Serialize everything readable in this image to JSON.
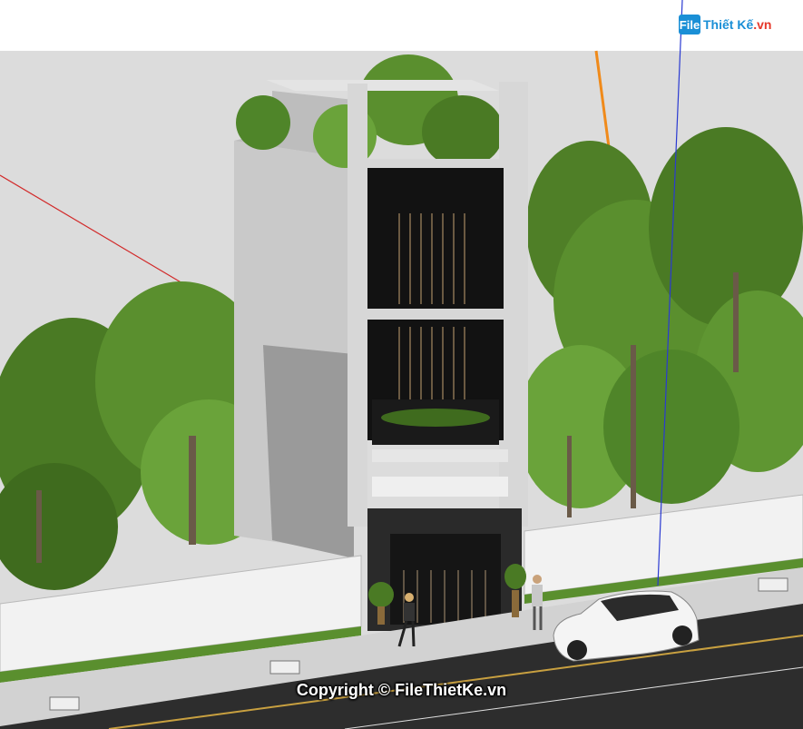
{
  "watermark_logo": {
    "badge": "File",
    "brand_prefix": "Thiết Kế",
    "brand_suffix": ".vn"
  },
  "copyright": "Copyright © FileThietKe.vn",
  "colors": {
    "sky": "#ffffff",
    "ground": "#dcdcdc",
    "tree_dark": "#3f6b1e",
    "tree_light": "#6aa33a",
    "wall": "#f2f2f2",
    "facade_concrete": "#d7d7d7",
    "facade_black": "#121212",
    "road": "#2d2d2d",
    "axis_red": "#d22a2a",
    "axis_blue": "#2a3ad2",
    "axis_orange": "#f08a1a",
    "brand": "#1a8fd6"
  }
}
